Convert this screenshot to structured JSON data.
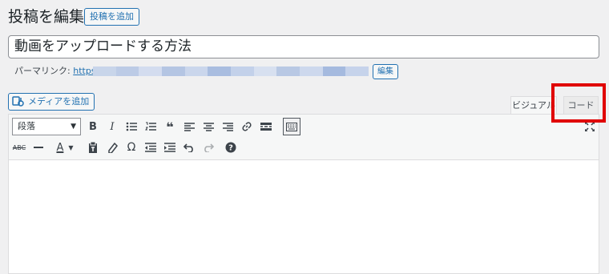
{
  "header": {
    "title": "投稿を編集",
    "add_new_label": "投稿を追加"
  },
  "post_title": {
    "value": "動画をアップロードする方法"
  },
  "permalink": {
    "label": "パーマリンク:",
    "url_prefix": "https://",
    "edit_label": "編集"
  },
  "media_button": {
    "label": "メディアを追加"
  },
  "tabs": [
    {
      "label": "ビジュアル"
    },
    {
      "label": "コード"
    }
  ],
  "toolbar": {
    "format_select": "段落",
    "row1_icons": [
      "bold-icon",
      "italic-icon",
      "bullet-list-icon",
      "numbered-list-icon",
      "blockquote-icon",
      "align-left-icon",
      "align-center-icon",
      "align-right-icon",
      "link-icon",
      "read-more-icon",
      "toolbar-toggle-icon"
    ],
    "row2_icons": [
      "strikethrough-icon",
      "horizontal-line-icon",
      "text-color-icon",
      "paste-text-icon",
      "clear-formatting-icon",
      "special-character-icon",
      "outdent-icon",
      "indent-icon",
      "undo-icon",
      "redo-icon",
      "help-icon"
    ]
  },
  "colors": {
    "accent": "#2271b1",
    "highlight": "#e00000"
  }
}
